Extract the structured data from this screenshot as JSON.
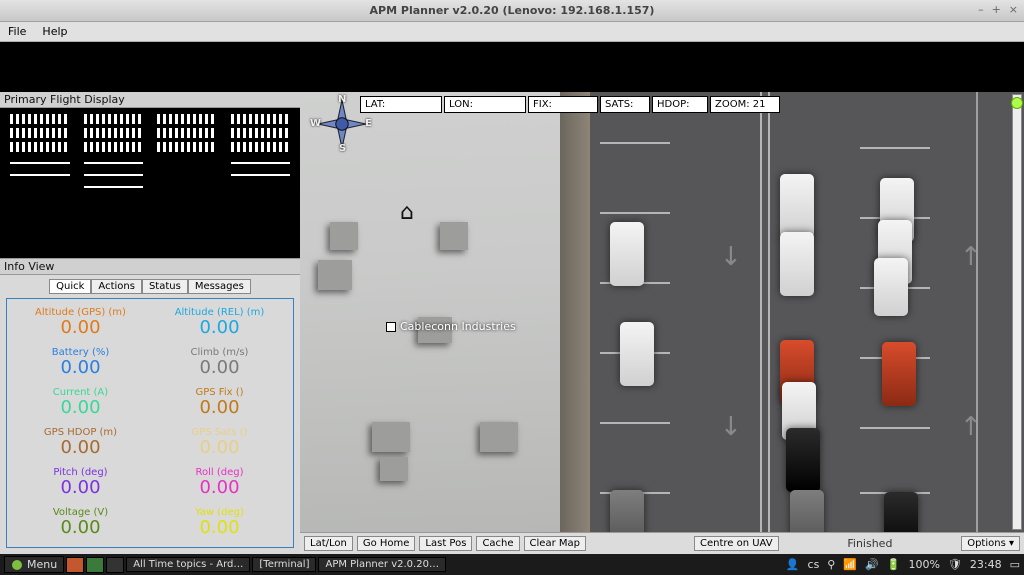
{
  "window": {
    "title": "APM Planner v2.0.20 (Lenovo: 192.168.1.157)",
    "btn_min": "–",
    "btn_max": "+",
    "btn_close": "×"
  },
  "menubar": {
    "file": "File",
    "help": "Help"
  },
  "pfd": {
    "title": "Primary Flight Display"
  },
  "infoview": {
    "title": "Info View",
    "tabs": [
      "Quick",
      "Actions",
      "Status",
      "Messages"
    ],
    "active_tab": 0
  },
  "telemetry": [
    {
      "label": "Altitude (GPS) (m)",
      "value": "0.00",
      "color": "#e07a1a"
    },
    {
      "label": "Altitude (REL) (m)",
      "value": "0.00",
      "color": "#1ea7e0"
    },
    {
      "label": "Battery (%)",
      "value": "0.00",
      "color": "#2a7fe0"
    },
    {
      "label": "Climb (m/s)",
      "value": "0.00",
      "color": "#7a7a7a"
    },
    {
      "label": "Current (A)",
      "value": "0.00",
      "color": "#39d79a"
    },
    {
      "label": "GPS Fix ()",
      "value": "0.00",
      "color": "#c07a1a"
    },
    {
      "label": "GPS HDOP (m)",
      "value": "0.00",
      "color": "#a86a30"
    },
    {
      "label": "GPS Sats ()",
      "value": "0.00",
      "color": "#e7cf86"
    },
    {
      "label": "Pitch (deg)",
      "value": "0.00",
      "color": "#7a33e0"
    },
    {
      "label": "Roll (deg)",
      "value": "0.00",
      "color": "#e531c4"
    },
    {
      "label": "Voltage (V)",
      "value": "0.00",
      "color": "#5a8a1a"
    },
    {
      "label": "Yaw (deg)",
      "value": "0.00",
      "color": "#e0e010"
    }
  ],
  "map": {
    "readouts": {
      "lat": "LAT:",
      "lon": "LON:",
      "fix": "FIX:",
      "sats": "SATS:",
      "hdop": "HDOP:",
      "zoom": "ZOOM: 21"
    },
    "compass": {
      "n": "N",
      "s": "S",
      "e": "E",
      "w": "W"
    },
    "place_label": "Cableconn Industries",
    "toolbar": {
      "latlon": "Lat/Lon",
      "gohome": "Go Home",
      "lastpos": "Last Pos",
      "cache": "Cache",
      "clear": "Clear Map",
      "centre": "Centre on UAV",
      "status": "Finished",
      "options": "Options ▾"
    }
  },
  "taskbar": {
    "menu": "Menu",
    "tasks": [
      "All Time topics - Ard…",
      "[Terminal]",
      "APM Planner v2.0.20…"
    ],
    "tray": {
      "user": "cs",
      "battery": "100%",
      "clock": "23:48"
    }
  }
}
